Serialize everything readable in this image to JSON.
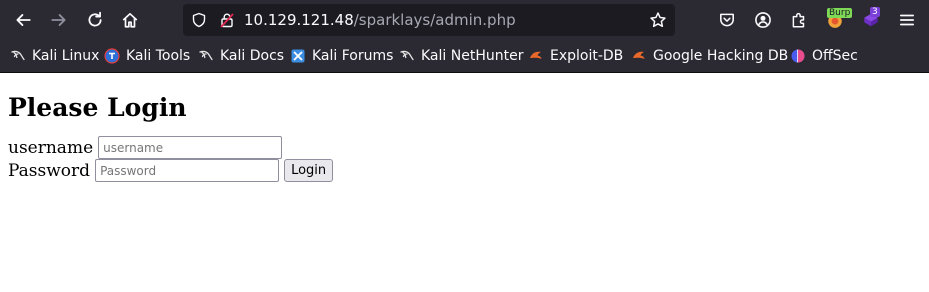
{
  "browser": {
    "url_host": "10.129.121.48",
    "url_path": "/sparklays/admin.php",
    "burp_badge": "Burp",
    "ext_count": "3"
  },
  "bookmarks": [
    {
      "label": "Kali Linux",
      "icon": "kali-dragon-icon"
    },
    {
      "label": "Kali Tools",
      "icon": "kali-tools-icon"
    },
    {
      "label": "Kali Docs",
      "icon": "kali-dragon-icon"
    },
    {
      "label": "Kali Forums",
      "icon": "kali-forums-icon"
    },
    {
      "label": "Kali NetHunter",
      "icon": "kali-dragon-icon"
    },
    {
      "label": "Exploit-DB",
      "icon": "exploit-db-icon"
    },
    {
      "label": "Google Hacking DB",
      "icon": "exploit-db-icon"
    },
    {
      "label": "OffSec",
      "icon": "offsec-icon"
    }
  ],
  "page": {
    "heading": "Please Login",
    "username_label": "username",
    "username_placeholder": "username",
    "password_label": "Password",
    "password_placeholder": "Password",
    "login_button": "Login"
  }
}
